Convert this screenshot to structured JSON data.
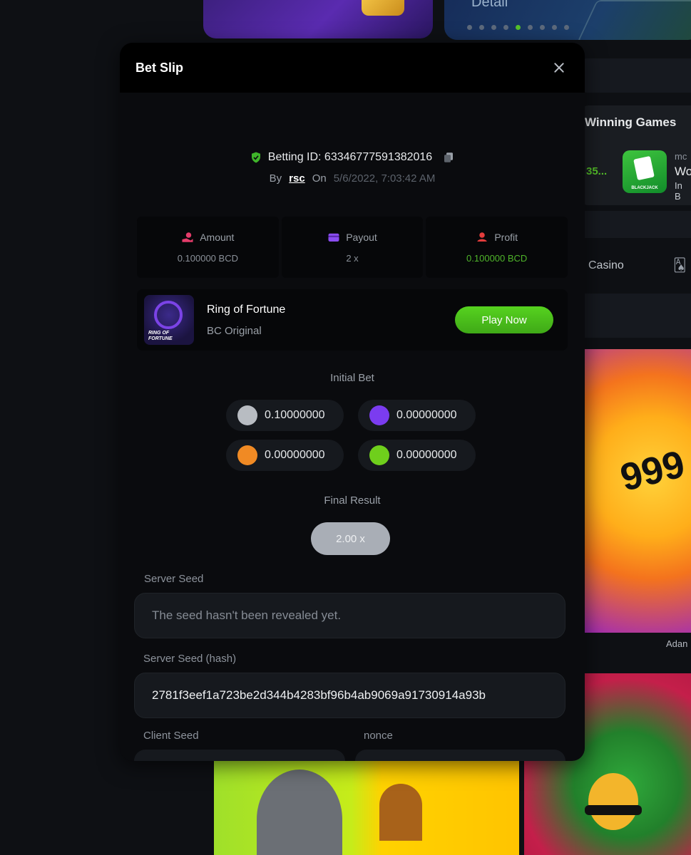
{
  "background": {
    "banner_text": "Detail",
    "winning_title": "Winning Games",
    "winning_amount": "35...",
    "blackjack_label": "BLACKJACK",
    "mc_text": "mc",
    "wo_text": "Wo",
    "inb_text": "In B",
    "casino_label": "Casino",
    "cards_icon": "🂡",
    "game_number": "999",
    "adam_text": "Adan",
    "carousel_dots": 9,
    "carousel_active_dot": 4
  },
  "modal": {
    "title": "Bet Slip",
    "betting_id_label": "Betting ID: 63346777591382016",
    "by_label": "By",
    "user": "rsc",
    "on_label": "On",
    "date": "5/6/2022, 7:03:42 AM",
    "stats": {
      "amount_label": "Amount",
      "amount_value": "0.100000 BCD",
      "payout_label": "Payout",
      "payout_value": "2 x",
      "profit_label": "Profit",
      "profit_value": "0.100000 BCD"
    },
    "game": {
      "name": "Ring of Fortune",
      "provider": "BC Original",
      "thumb_label": "RING OF FORTUNE",
      "play_label": "Play Now"
    },
    "initial_bet_title": "Initial Bet",
    "coins": [
      {
        "value": "0.10000000",
        "color": "#b8bcc2"
      },
      {
        "value": "0.00000000",
        "color": "#7b3cf0"
      },
      {
        "value": "0.00000000",
        "color": "#f08a24"
      },
      {
        "value": "0.00000000",
        "color": "#6fcf1c"
      }
    ],
    "final_result_title": "Final Result",
    "final_result": "2.00 x",
    "server_seed_label": "Server Seed",
    "server_seed_placeholder": "The seed hasn't been revealed yet.",
    "server_seed_hash_label": "Server Seed (hash)",
    "server_seed_hash": "2781f3eef1a723be2d344b4283bf96b4ab9069a91730914a93b",
    "client_seed_label": "Client Seed",
    "nonce_label": "nonce"
  },
  "colors": {
    "accent_green": "#4fb52a",
    "modal_bg": "#0a0b0e",
    "page_bg": "#0e1014"
  }
}
